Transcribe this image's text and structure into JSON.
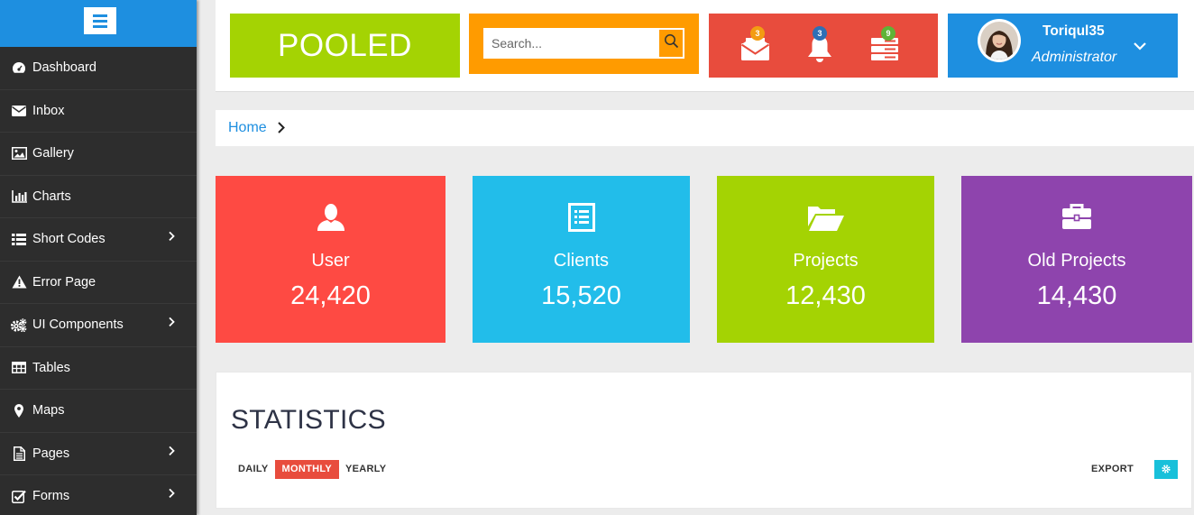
{
  "app": {
    "logo_text": "POOLED"
  },
  "sidebar": {
    "items": [
      {
        "label": "Dashboard",
        "icon": "dashboard-icon",
        "has_submenu": false
      },
      {
        "label": "Inbox",
        "icon": "envelope-icon",
        "has_submenu": false
      },
      {
        "label": "Gallery",
        "icon": "picture-icon",
        "has_submenu": false
      },
      {
        "label": "Charts",
        "icon": "bar-chart-icon",
        "has_submenu": false
      },
      {
        "label": "Short Codes",
        "icon": "list-icon",
        "has_submenu": true
      },
      {
        "label": "Error Page",
        "icon": "warning-icon",
        "has_submenu": false
      },
      {
        "label": "UI Components",
        "icon": "cogs-icon",
        "has_submenu": true
      },
      {
        "label": "Tables",
        "icon": "table-icon",
        "has_submenu": false
      },
      {
        "label": "Maps",
        "icon": "map-marker-icon",
        "has_submenu": false
      },
      {
        "label": "Pages",
        "icon": "file-icon",
        "has_submenu": true
      },
      {
        "label": "Forms",
        "icon": "check-square-icon",
        "has_submenu": true
      }
    ]
  },
  "header": {
    "search_placeholder": "Search...",
    "notifications": [
      {
        "icon": "envelope-icon",
        "count": "3",
        "badge_color": "#f39c12"
      },
      {
        "icon": "bell-icon",
        "count": "3",
        "badge_color": "#2f6fb5"
      },
      {
        "icon": "server-icon",
        "count": "9",
        "badge_color": "#5fb336"
      }
    ],
    "user": {
      "name": "Toriqul35",
      "role": "Administrator"
    }
  },
  "breadcrumb": {
    "home": "Home"
  },
  "cards": [
    {
      "label": "User",
      "value": "24,420",
      "color": "#fe4a43",
      "icon": "user-icon"
    },
    {
      "label": "Clients",
      "value": "15,520",
      "color": "#22bdea",
      "icon": "list-alt-icon"
    },
    {
      "label": "Projects",
      "value": "12,430",
      "color": "#a4d303",
      "icon": "folder-open-icon"
    },
    {
      "label": "Old Projects",
      "value": "14,430",
      "color": "#8e44ad",
      "icon": "briefcase-icon"
    }
  ],
  "statistics": {
    "title": "STATISTICS",
    "tabs": [
      "DAILY",
      "MONTHLY",
      "YEARLY"
    ],
    "active_tab": "MONTHLY",
    "export_label": "EXPORT"
  },
  "colors": {
    "primary": "#1e8fe0",
    "sidebar_bg": "#2d2d2d",
    "green": "#a4d303",
    "orange": "#ff9b00",
    "red": "#e84c3d",
    "cyan": "#18c0da"
  }
}
